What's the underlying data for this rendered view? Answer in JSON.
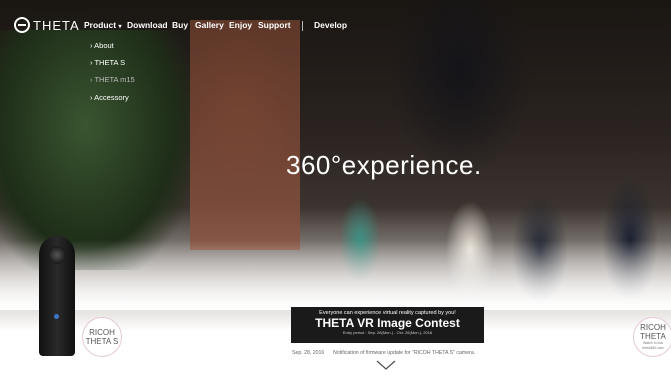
{
  "brand": {
    "name": "THETA"
  },
  "nav": {
    "items": [
      {
        "label": "Product",
        "dropdown": true
      },
      {
        "label": "Download"
      },
      {
        "label": "Buy"
      },
      {
        "label": "Gallery"
      },
      {
        "label": "Enjoy"
      },
      {
        "label": "Support"
      },
      {
        "label": "Develop"
      }
    ],
    "dropdown_caret": "▾",
    "product_submenu": [
      {
        "label": "› About"
      },
      {
        "label": "› THETA S"
      },
      {
        "label": "› THETA m15"
      },
      {
        "label": "› Accessory"
      }
    ]
  },
  "hero": {
    "headline": "360°experience."
  },
  "banner": {
    "line1": "Everyone can experience virtual reality captured by you!",
    "title": "THETA VR Image Contest",
    "period": "Entry period : Sep. 28(Mon.) - Oct. 26(Mon.),  2016"
  },
  "badges": {
    "left": [
      "RICOH",
      "THETA S"
    ],
    "right": [
      "RICOH",
      "THETA",
      "Watch it now",
      "theta360.com"
    ]
  },
  "news": {
    "date": "Sep. 28, 2016",
    "text": "Notification of firmware update for \"RICOH THETA S\" camera."
  },
  "icons": {
    "logo": "theta-logo-icon",
    "scroll": "chevron-down-icon"
  },
  "colors": {
    "banner_bg": "#1a1a1a",
    "camera_accent": "#3b76c9",
    "nav_text": "#ffffff"
  }
}
